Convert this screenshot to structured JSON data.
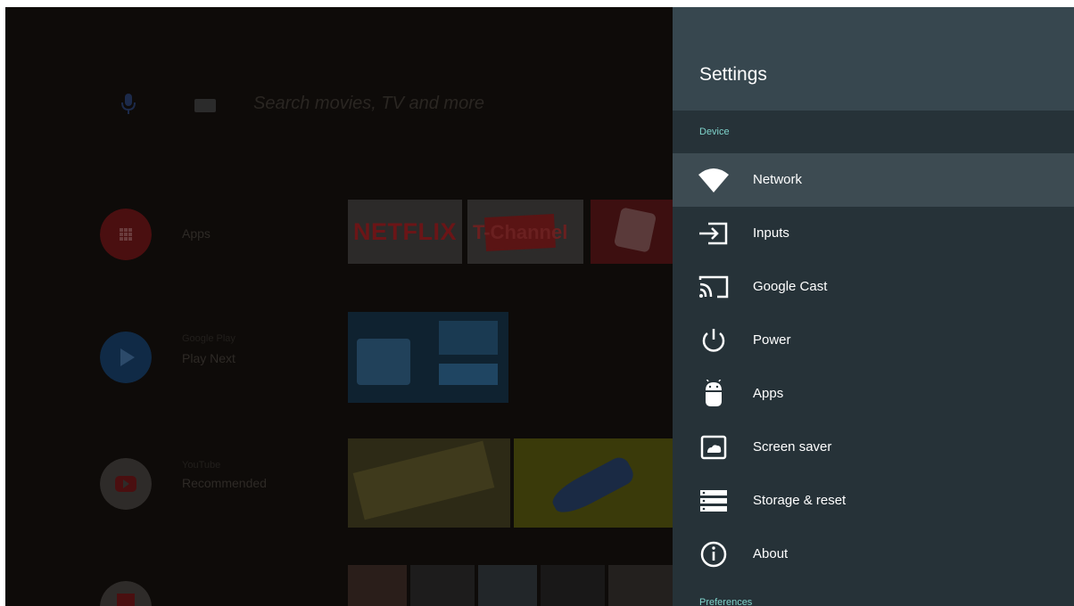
{
  "home": {
    "search_placeholder": "Search movies, TV and more",
    "rows": [
      {
        "label": "Apps",
        "sublabel": ""
      },
      {
        "label": "Play Next",
        "sublabel": "Google Play"
      },
      {
        "label": "Recommended",
        "sublabel": "YouTube"
      }
    ],
    "tiles": {
      "netflix": "NETFLIX",
      "tchannel": "T-Channel"
    }
  },
  "settings": {
    "title": "Settings",
    "sections": {
      "device": "Device",
      "preferences": "Preferences"
    },
    "items": [
      {
        "label": "Network",
        "icon": "wifi-icon",
        "selected": true
      },
      {
        "label": "Inputs",
        "icon": "input-icon"
      },
      {
        "label": "Google Cast",
        "icon": "cast-icon"
      },
      {
        "label": "Power",
        "icon": "power-icon"
      },
      {
        "label": "Apps",
        "icon": "android-icon"
      },
      {
        "label": "Screen saver",
        "icon": "screen-saver-icon"
      },
      {
        "label": "Storage & reset",
        "icon": "storage-icon"
      },
      {
        "label": "About",
        "icon": "info-icon"
      }
    ]
  },
  "colors": {
    "panel_bg": "#263238",
    "panel_header": "#37474f",
    "selected_item": "#3d4b52",
    "section_label": "#7fd3cb",
    "overlay_dim": "#0f0c0a"
  }
}
